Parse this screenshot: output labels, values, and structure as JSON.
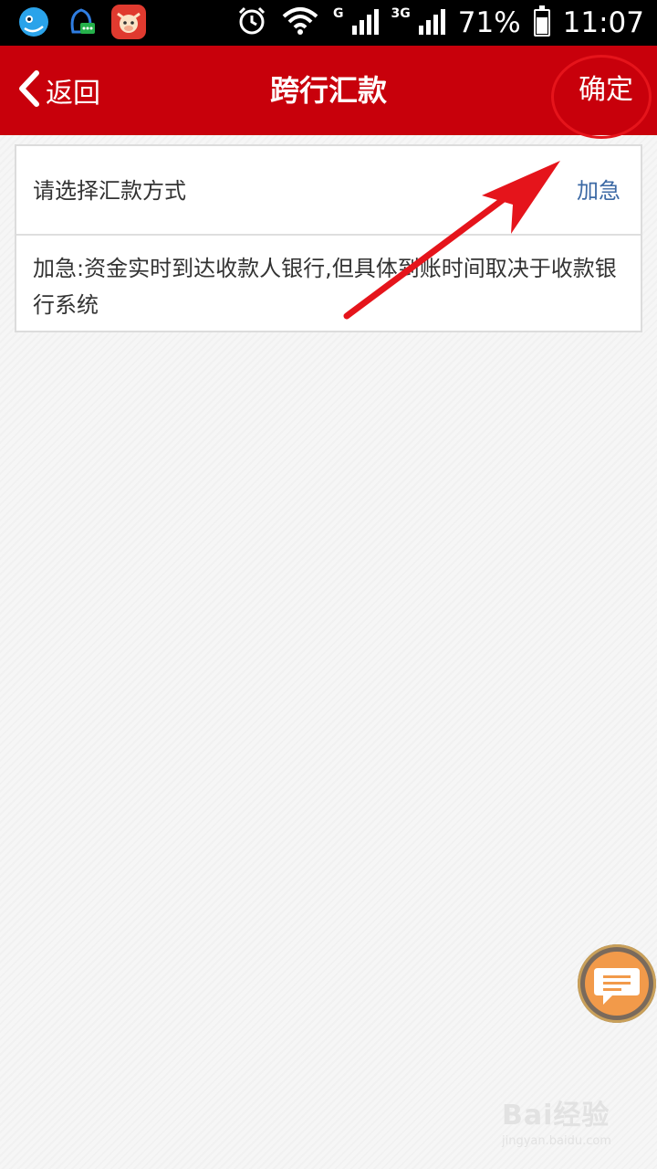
{
  "status_bar": {
    "network_label_1": "G",
    "network_label_2": "3G",
    "battery": "71%",
    "battery_level": 0.71,
    "time": "11:07"
  },
  "header": {
    "back_label": "返回",
    "title": "跨行汇款",
    "confirm_label": "确定",
    "background_color": "#c8000b"
  },
  "remit_method": {
    "label": "请选择汇款方式",
    "value": "加急",
    "value_color": "#3d6aa5",
    "description": "加急:资金实时到达收款人银行,但具体到账时间取决于收款银行系统"
  },
  "watermark": {
    "main": "Bai经验",
    "sub": "jingyan.baidu.com"
  },
  "annotation_color": "#e5141b"
}
